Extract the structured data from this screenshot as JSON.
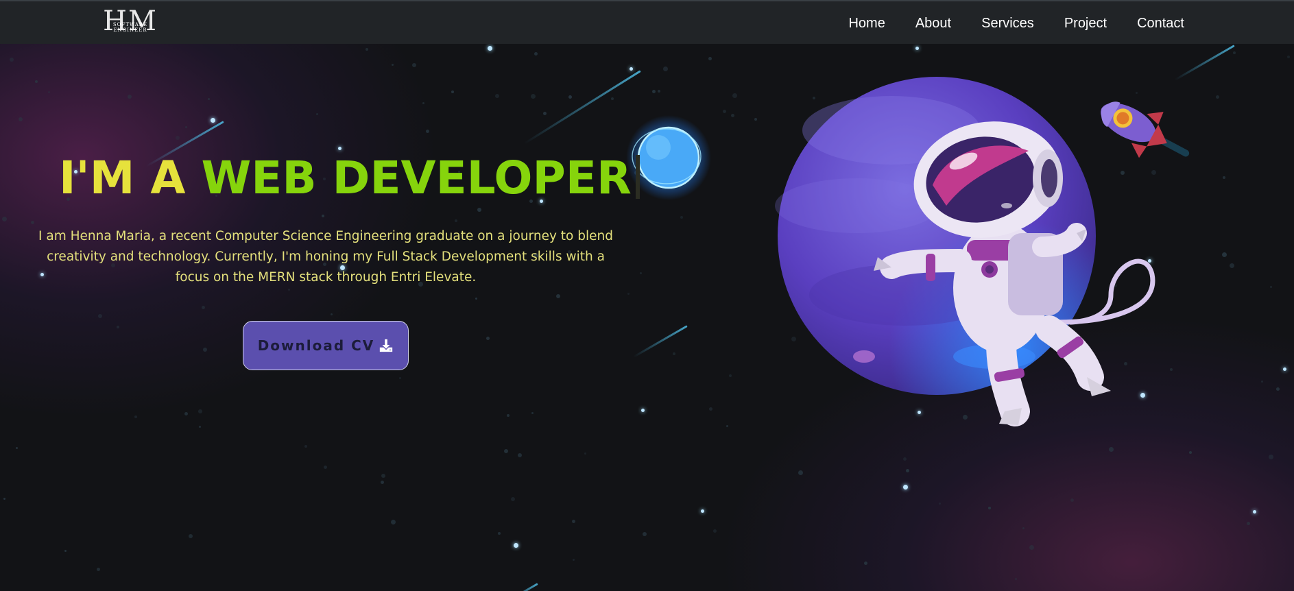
{
  "nav": {
    "logo_letters": "HM",
    "logo_subtitle": "SOFTWARE ENGINEER",
    "links": [
      "Home",
      "About",
      "Services",
      "Project",
      "Contact"
    ]
  },
  "hero": {
    "headline_part1": "I'M A ",
    "headline_part2": "WEB DEVELOPER",
    "intro": "I am Henna Maria, a recent Computer Science Engineering graduate on a journey to blend creativity and technology. Currently, I'm honing my Full Stack Development skills with a focus on the MERN stack through Entri Elevate.",
    "cta_label": "Download CV"
  },
  "icons": {
    "download": "download-icon",
    "astronaut": "astronaut-illustration",
    "planet": "planet-illustration",
    "rocket": "rocket-illustration",
    "moon": "glowing-moon-illustration"
  },
  "colors": {
    "background": "#121316",
    "navbar": "#212427",
    "headline_yellow": "#e6e23c",
    "headline_green": "#86d40c",
    "intro_text": "#e4e07c",
    "button": "#5b4fae",
    "planet": "#6a4fd0"
  }
}
